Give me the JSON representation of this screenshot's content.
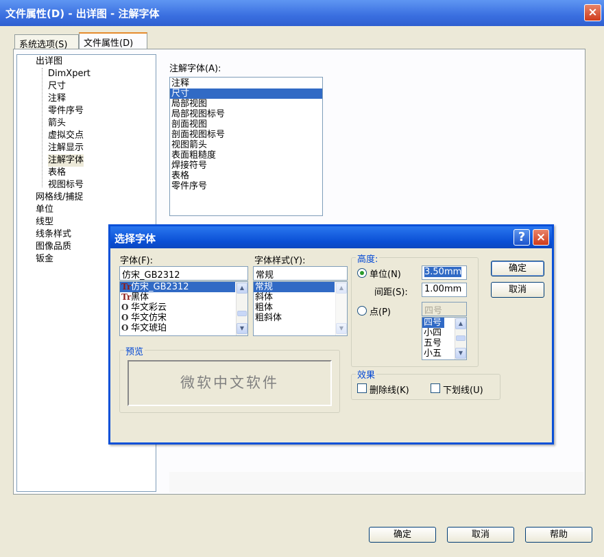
{
  "window": {
    "title": "文件属性(D) - 出详图 - 注解字体",
    "close": "×"
  },
  "tabs": [
    "系统选项(S)",
    "文件属性(D)"
  ],
  "tree": {
    "root": "出详图",
    "children": [
      "DimXpert",
      "尺寸",
      "注释",
      "零件序号",
      "箭头",
      "虚拟交点",
      "注解显示",
      "注解字体",
      "表格",
      "视图标号"
    ],
    "top": [
      "网格线/捕捉",
      "单位",
      "线型",
      "线条样式",
      "图像品质",
      "钣金"
    ]
  },
  "annotation": {
    "label": "注解字体(A):",
    "items": [
      "注释",
      "尺寸",
      "局部视图",
      "局部视图标号",
      "剖面视图",
      "剖面视图标号",
      "视图箭头",
      "表面粗糙度",
      "焊接符号",
      "表格",
      "零件序号"
    ],
    "selected": "尺寸"
  },
  "buttons": {
    "ok": "确定",
    "cancel": "取消",
    "help": "帮助"
  },
  "font_dialog": {
    "title": "选择字体",
    "help": "?",
    "close": "×",
    "font_label": "字体(F):",
    "font_value": "仿宋_GB2312",
    "fonts": [
      {
        "icon": "Tr",
        "name": "仿宋_GB2312"
      },
      {
        "icon": "Tr",
        "name": "黑体"
      },
      {
        "icon": "O",
        "name": "华文彩云"
      },
      {
        "icon": "O",
        "name": "华文仿宋"
      },
      {
        "icon": "O",
        "name": "华文琥珀"
      }
    ],
    "style_label": "字体样式(Y):",
    "style_value": "常规",
    "styles": [
      "常规",
      "斜体",
      "粗体",
      "粗斜体"
    ],
    "height_group": "高度:",
    "unit_label": "单位(N)",
    "unit_value": "3.50mm",
    "spacing_label": "间距(S):",
    "spacing_value": "1.00mm",
    "point_label": "点(P)",
    "point_value": "四号",
    "points": [
      "四号",
      "小四",
      "五号",
      "小五"
    ],
    "ok": "确定",
    "cancel": "取消",
    "preview_group": "预览",
    "preview_text": "微软中文软件",
    "effects_group": "效果",
    "strike_label": "删除线(K)",
    "underline_label": "下划线(U)"
  }
}
